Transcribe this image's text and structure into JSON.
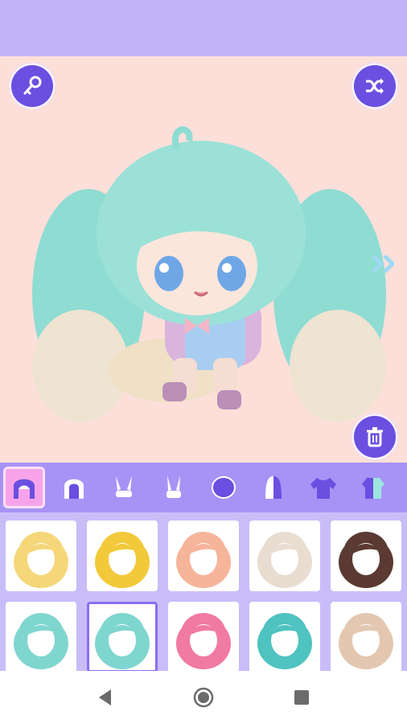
{
  "app": {
    "colors": {
      "topbar": "#c2b3f7",
      "stage_bg": "#fddfda",
      "button": "#6a4fe0",
      "category_bar": "#a793f6",
      "category_active": "#f7a3e9",
      "grid_bg": "#c9bdf9"
    }
  },
  "toolbar": {
    "key_icon": "key-icon",
    "shuffle_icon": "shuffle-icon",
    "trash_icon": "trash-icon",
    "next_icon": "double-chevron-right-icon"
  },
  "categories": [
    {
      "name": "front-hair",
      "icon": "front-hair-icon",
      "active": true
    },
    {
      "name": "back-hair",
      "icon": "back-hair-icon",
      "active": false
    },
    {
      "name": "ears-1",
      "icon": "bunny-ears-icon",
      "active": false
    },
    {
      "name": "ears-2",
      "icon": "bunny-ears-alt-icon",
      "active": false
    },
    {
      "name": "hat",
      "icon": "hood-icon",
      "active": false
    },
    {
      "name": "side-hair",
      "icon": "side-hair-icon",
      "active": false
    },
    {
      "name": "top",
      "icon": "shirt-icon",
      "active": false
    },
    {
      "name": "outfit",
      "icon": "outfit-icon",
      "active": false
    }
  ],
  "items": [
    {
      "hair_color": "#f5d77a",
      "selected": false
    },
    {
      "hair_color": "#f1c93a",
      "selected": false
    },
    {
      "hair_color": "#f6b59a",
      "selected": false
    },
    {
      "hair_color": "#e9ddd1",
      "selected": false
    },
    {
      "hair_color": "#5a3a32",
      "selected": false
    },
    {
      "hair_color": "#7fd6cf",
      "selected": false
    },
    {
      "hair_color": "#7fd6cf",
      "selected": true
    },
    {
      "hair_color": "#f07aa2",
      "selected": false
    },
    {
      "hair_color": "#4fc3c0",
      "selected": false
    },
    {
      "hair_color": "#e3c7b0",
      "selected": false
    }
  ],
  "navigation": {
    "back_icon": "back-triangle-icon",
    "home_icon": "home-circle-icon",
    "recents_icon": "recents-square-icon"
  }
}
